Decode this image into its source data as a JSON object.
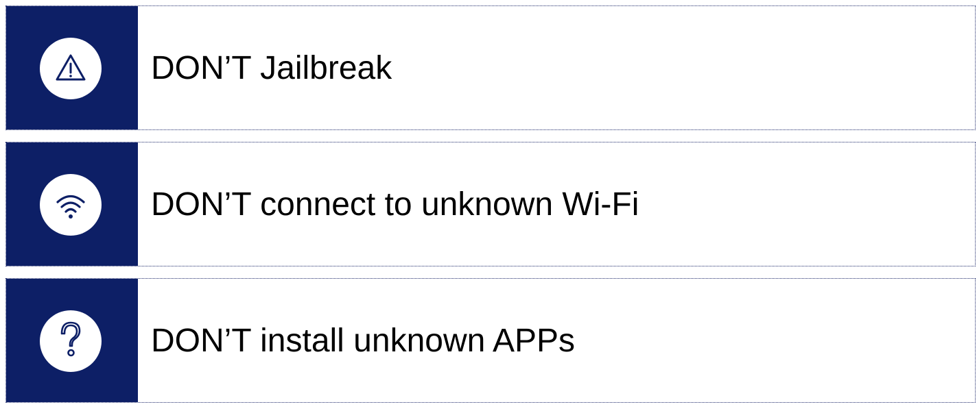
{
  "items": [
    {
      "icon": "warning-triangle-icon",
      "text": "DON’T Jailbreak"
    },
    {
      "icon": "wifi-icon",
      "text": "DON’T connect to unknown Wi-Fi"
    },
    {
      "icon": "question-mark-icon",
      "text": "DON’T install unknown APPs"
    }
  ],
  "colors": {
    "panel": "#0d1f66",
    "icon_circle": "#ffffff",
    "icon_stroke": "#0d1f66",
    "border": "#1f2a6b",
    "text": "#000000"
  }
}
